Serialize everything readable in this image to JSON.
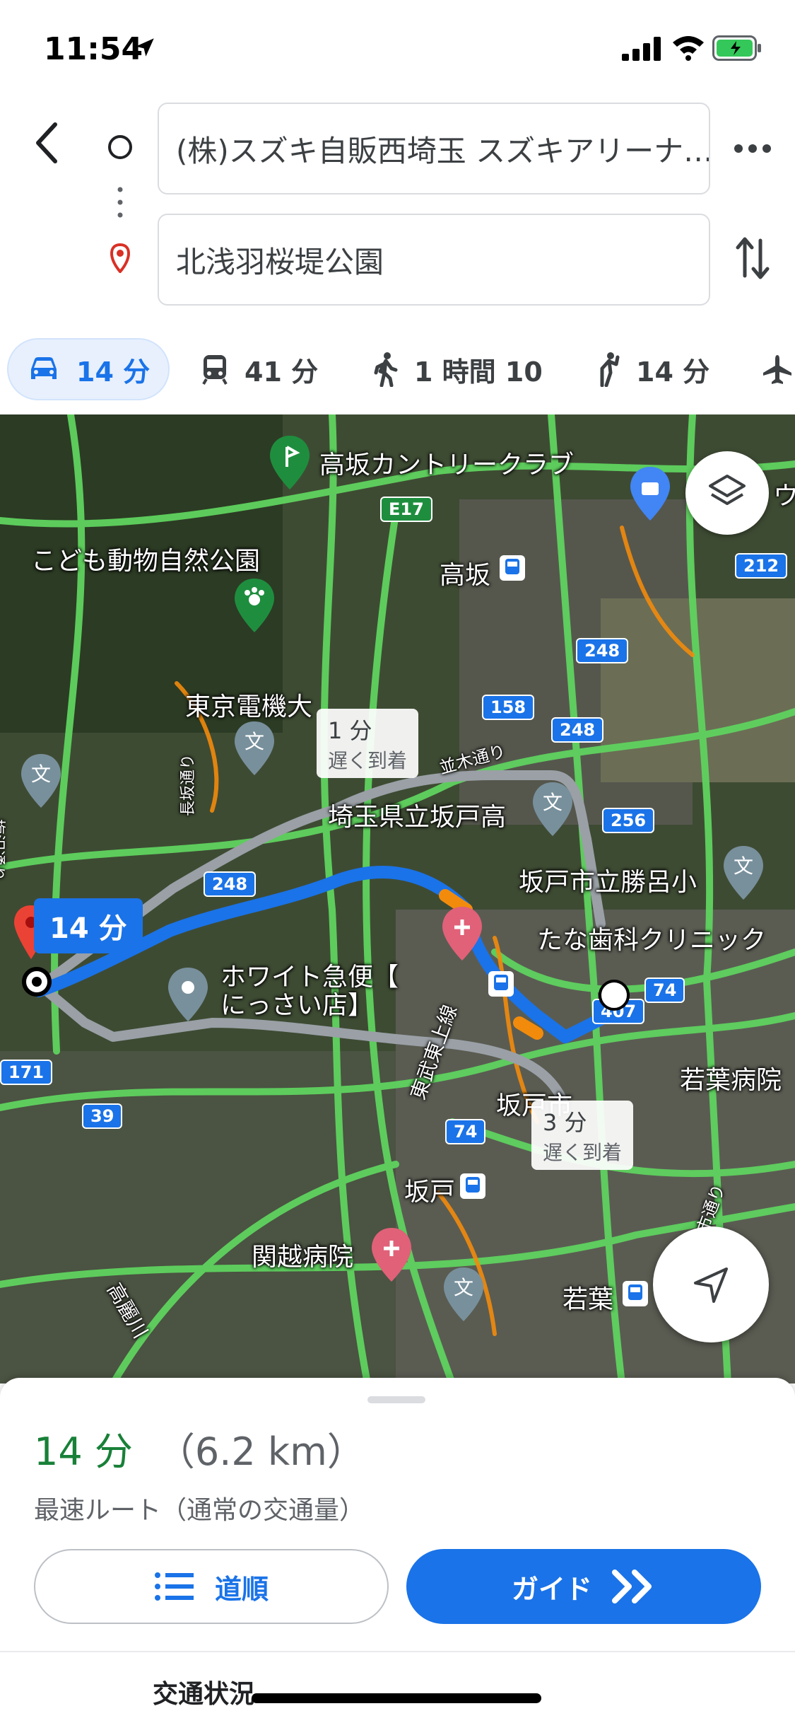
{
  "status_bar": {
    "time": "11:54"
  },
  "header": {
    "origin": "(株)スズキ自販西埼玉 スズキアリーナ…",
    "destination": "北浅羽桜堤公園"
  },
  "travel_modes": [
    {
      "icon": "car-icon",
      "label": "14 分",
      "selected": true
    },
    {
      "icon": "transit-icon",
      "label": "41 分",
      "selected": false
    },
    {
      "icon": "walk-icon",
      "label": "1 時間 10",
      "selected": false
    },
    {
      "icon": "rideshare-icon",
      "label": "14 分",
      "selected": false
    },
    {
      "icon": "flight-icon",
      "label": "",
      "selected": false
    }
  ],
  "map": {
    "labels": {
      "takasaka_cc": "高坂カントリークラブ",
      "kodomo_park": "こども動物自然公園",
      "takasaka": "高坂",
      "tokyo_denki": "東京電機大",
      "saitama_sakado": "埼玉県立坂戸高",
      "sakado_katsuro": "坂戸市立勝呂小",
      "tana_clinic": "たな歯科クリニック",
      "white_kyubin": "ホワイト急便【\nにっさい店】",
      "wakaba_hospital": "若葉病院",
      "sakado_city": "坂戸市",
      "sakado": "坂戸",
      "kanetsu_hospital": "関越病院",
      "wakaba": "若葉",
      "tobu_tojo": "東武東上線",
      "namiki_dori": "並木通り",
      "nagasaka_dori": "長坂通り",
      "umezawa_dori": "梅沢通り",
      "koma_river": "高麗川",
      "partial_u": "ウ",
      "partial_dori": "市通り"
    },
    "route_shields": [
      "E17",
      "212",
      "248",
      "158",
      "248",
      "256",
      "248",
      "74",
      "407",
      "171",
      "39",
      "74"
    ],
    "time_bubble": "14 分",
    "alt_routes": [
      {
        "time": "1 分",
        "note": "遅く到着"
      },
      {
        "time": "3 分",
        "note": "遅く到着"
      }
    ]
  },
  "sheet": {
    "duration": "14 分",
    "distance": "（6.2 km）",
    "description": "最速ルート（通常の交通量）",
    "steps_label": "道順",
    "guide_label": "ガイド",
    "traffic_label": "交通状況"
  },
  "colors": {
    "accent": "#1a73e8",
    "duration_green": "#188038",
    "traffic_green": "#5fd35f",
    "traffic_orange": "#f28b0c",
    "alt_route": "#9aa0a6"
  }
}
